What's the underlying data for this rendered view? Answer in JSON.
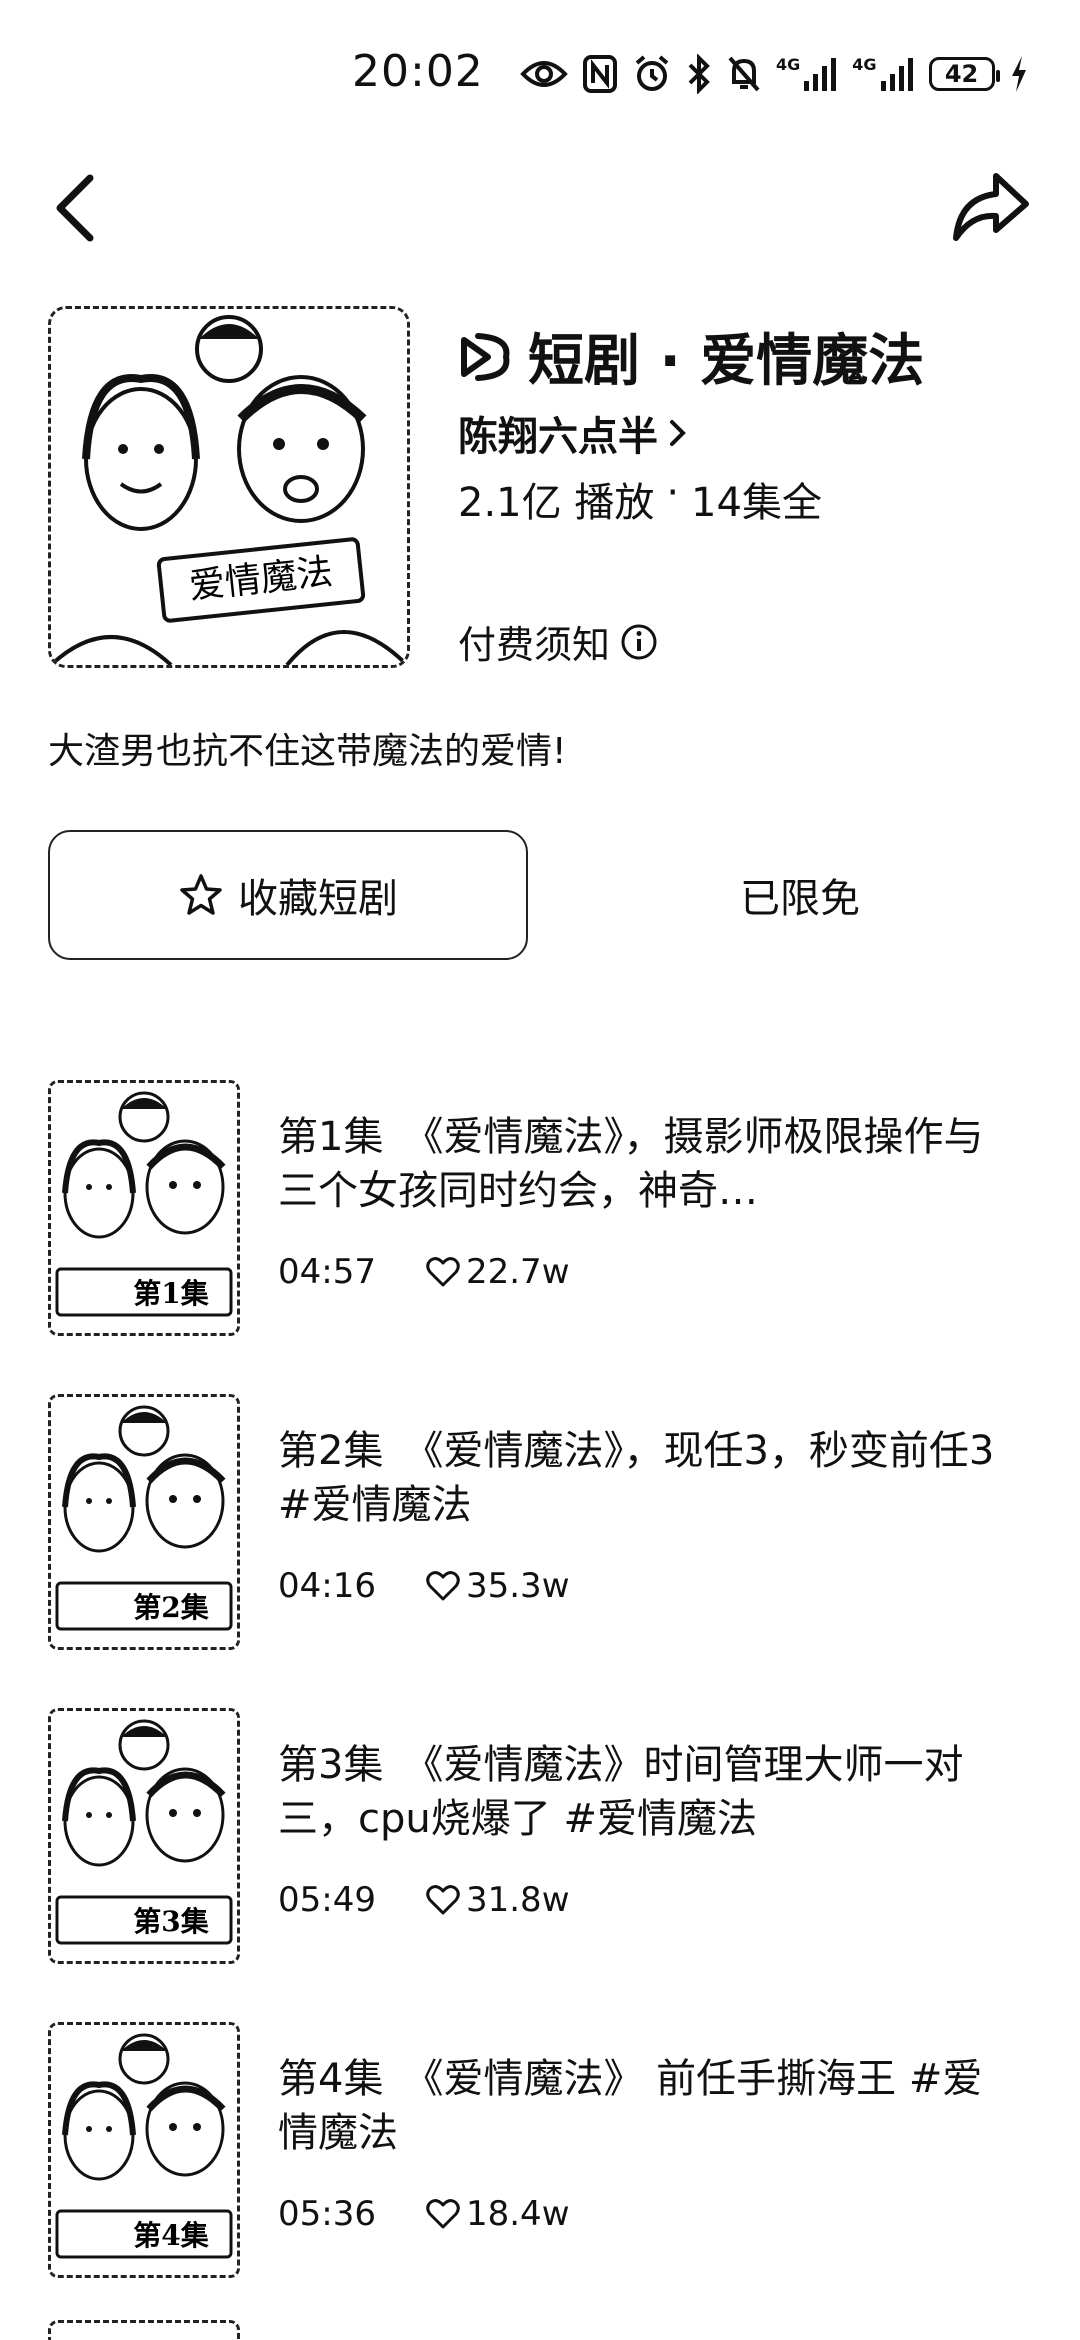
{
  "status_bar": {
    "time": "20:02",
    "battery": "42",
    "network_tag": "4G"
  },
  "drama": {
    "title": "短剧 · 爱情魔法",
    "author": "陈翔六点半",
    "plays": "2.1亿 播放",
    "episodes_total": "14集全",
    "paid_notice": "付费须知",
    "description": "大渣男也抗不住这带魔法的爱情!",
    "cover_badge": "爱情魔法"
  },
  "actions": {
    "favorite_label": "收藏短剧",
    "free_label": "已限免"
  },
  "episodes": [
    {
      "title": "第1集　《爱情魔法》，摄影师极限操作与三个女孩同时约会，神奇…",
      "duration": "04:57",
      "likes": "22.7w",
      "badge": "第1集"
    },
    {
      "title": "第2集　《爱情魔法》，现任3，秒变前任3 #爱情魔法",
      "duration": "04:16",
      "likes": "35.3w",
      "badge": "第2集"
    },
    {
      "title": "第3集　《爱情魔法》时间管理大师一对三，cpu烧爆了 #爱情魔法",
      "duration": "05:49",
      "likes": "31.8w",
      "badge": "第3集"
    },
    {
      "title": "第4集　《爱情魔法》 前任手撕海王 #爱情魔法",
      "duration": "05:36",
      "likes": "18.4w",
      "badge": "第4集"
    }
  ]
}
